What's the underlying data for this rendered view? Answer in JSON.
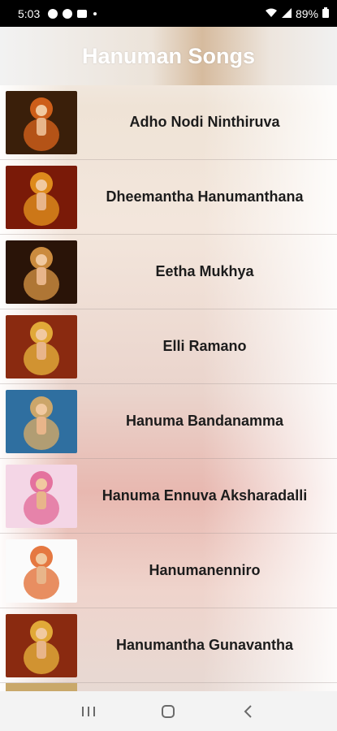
{
  "status_bar": {
    "time": "5:03",
    "battery_percent": "89%",
    "icons": [
      "pinterest-icon",
      "pinterest-icon",
      "message-icon",
      "dot-icon",
      "wifi-icon",
      "signal-icon",
      "battery-icon"
    ]
  },
  "app": {
    "title": "Hanuman Songs"
  },
  "songs": [
    {
      "title": "Adho Nodi Ninthiruva",
      "thumb_bg": "#3a1f0a",
      "thumb_accent": "#e86a1c"
    },
    {
      "title": "Dheemantha Hanumanthana",
      "thumb_bg": "#7a1a08",
      "thumb_accent": "#f0a020"
    },
    {
      "title": "Eetha Mukhya",
      "thumb_bg": "#2a1408",
      "thumb_accent": "#e8a048"
    },
    {
      "title": "Elli Ramano",
      "thumb_bg": "#8a2a10",
      "thumb_accent": "#f0c040"
    },
    {
      "title": "Hanuma Bandanamma",
      "thumb_bg": "#2f6fa0",
      "thumb_accent": "#e8b060"
    },
    {
      "title": "Hanuma Ennuva Aksharadalli",
      "thumb_bg": "#f4d6e6",
      "thumb_accent": "#e06090"
    },
    {
      "title": "Hanumanenniro",
      "thumb_bg": "#fbfbfb",
      "thumb_accent": "#e06020"
    },
    {
      "title": "Hanumantha Gunavantha",
      "thumb_bg": "#8a2a10",
      "thumb_accent": "#f0c040"
    }
  ],
  "nav": {
    "icons": [
      "recent-apps-icon",
      "home-icon",
      "back-icon"
    ]
  }
}
